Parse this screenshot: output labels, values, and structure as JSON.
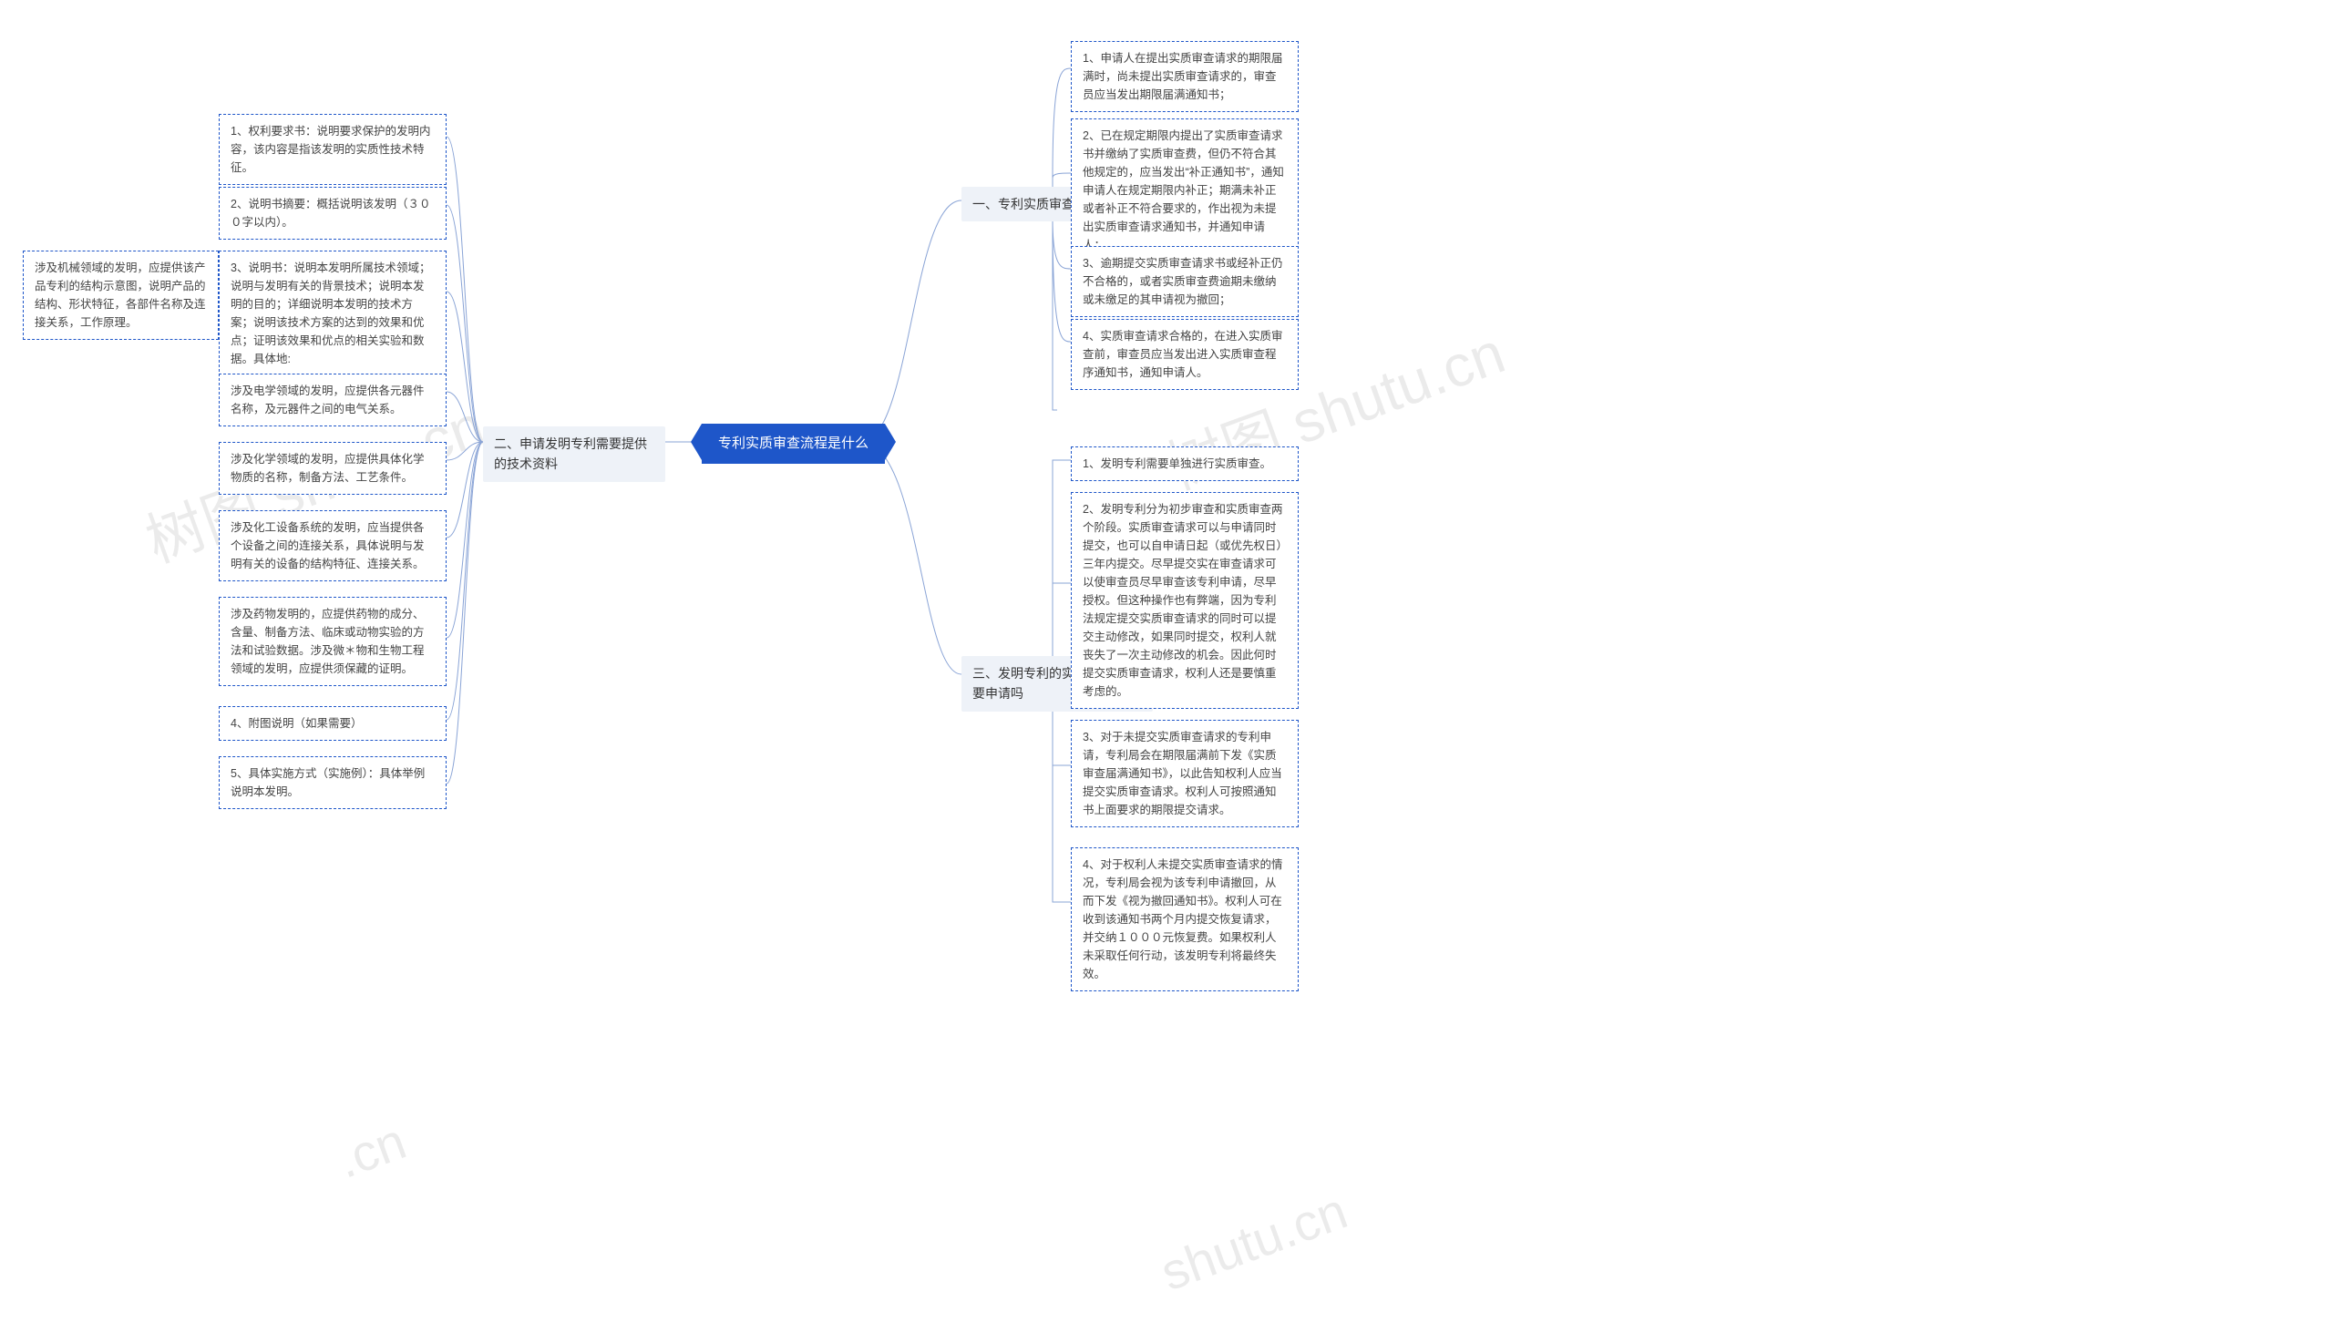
{
  "root": {
    "label": "专利实质审查流程是什么"
  },
  "branches": {
    "b1": {
      "label": "一、专利实质审查流程是什么"
    },
    "b2": {
      "label": "二、申请发明专利需要提供的技术资料"
    },
    "b3": {
      "label": "三、发明专利的实质审查还需要申请吗"
    }
  },
  "leaves": {
    "b1_1": "1、申请人在提出实质审查请求的期限届满时，尚未提出实质审查请求的，审查员应当发出期限届满通知书；",
    "b1_2": "2、已在规定期限内提出了实质审查请求书并缴纳了实质审查费，但仍不符合其他规定的，应当发出“补正通知书”，通知申请人在规定期限内补正；期满未补正或者补正不符合要求的，作出视为未提出实质审查请求通知书，并通知申请人；",
    "b1_3": "3、逾期提交实质审查请求书或经补正仍不合格的，或者实质审查费逾期未缴纳或未缴足的其申请视为撤回；",
    "b1_4": "4、实质审查请求合格的，在进入实质审查前，审查员应当发出进入实质审查程序通知书，通知申请人。",
    "b3_1": "1、发明专利需要单独进行实质审查。",
    "b3_2": "2、发明专利分为初步审查和实质审查两个阶段。实质审查请求可以与申请同时提交，也可以自申请日起（或优先权日）三年内提交。尽早提交实在审查请求可以使审查员尽早审查该专利申请，尽早授权。但这种操作也有弊端，因为专利法规定提交实质审查请求的同时可以提交主动修改，如果同时提交，权利人就丧失了一次主动修改的机会。因此何时提交实质审查请求，权利人还是要慎重考虑的。",
    "b3_3": "3、对于未提交实质审查请求的专利申请，专利局会在期限届满前下发《实质审查届满通知书》，以此告知权利人应当提交实质审查请求。权利人可按照通知书上面要求的期限提交请求。",
    "b3_4": "4、对于权利人未提交实质审查请求的情况，专利局会视为该专利申请撤回，从而下发《视为撤回通知书》。权利人可在收到该通知书两个月内提交恢复请求，并交纳１０００元恢复费。如果权利人未采取任何行动，该发明专利将最终失效。",
    "b2_1": "1、权利要求书：说明要求保护的发明内容，该内容是指该发明的实质性技术特征。",
    "b2_2": "2、说明书摘要：概括说明该发明（３００字以内）。",
    "b2_3": "3、说明书：说明本发明所属技术领域；说明与发明有关的背景技术；说明本发明的目的；详细说明本发明的技术方案；说明该技术方案的达到的效果和优点；证明该效果和优点的相关实验和数据。具体地:",
    "b2_3_a": "涉及机械领域的发明，应提供该产品专利的结构示意图，说明产品的结构、形状特征，各部件名称及连接关系，工作原理。",
    "b2_3_b": "涉及电学领域的发明，应提供各元器件名称，及元器件之间的电气关系。",
    "b2_3_c": "涉及化学领域的发明，应提供具体化学物质的名称，制备方法、工艺条件。",
    "b2_3_d": "涉及化工设备系统的发明，应当提供各个设备之间的连接关系，具体说明与发明有关的设备的结构特征、连接关系。",
    "b2_3_e": "涉及药物发明的，应提供药物的成分、含量、制备方法、临床或动物实验的方法和试验数据。涉及微＊物和生物工程领域的发明，应提供须保藏的证明。",
    "b2_4": "4、附图说明（如果需要）",
    "b2_5": "5、具体实施方式（实施例）：具体举例说明本发明。"
  },
  "watermarks": {
    "w1": "树图 shutu.cn",
    "w2": "树图 shutu.cn",
    "w3": "shutu.cn",
    "w4": ".cn"
  }
}
